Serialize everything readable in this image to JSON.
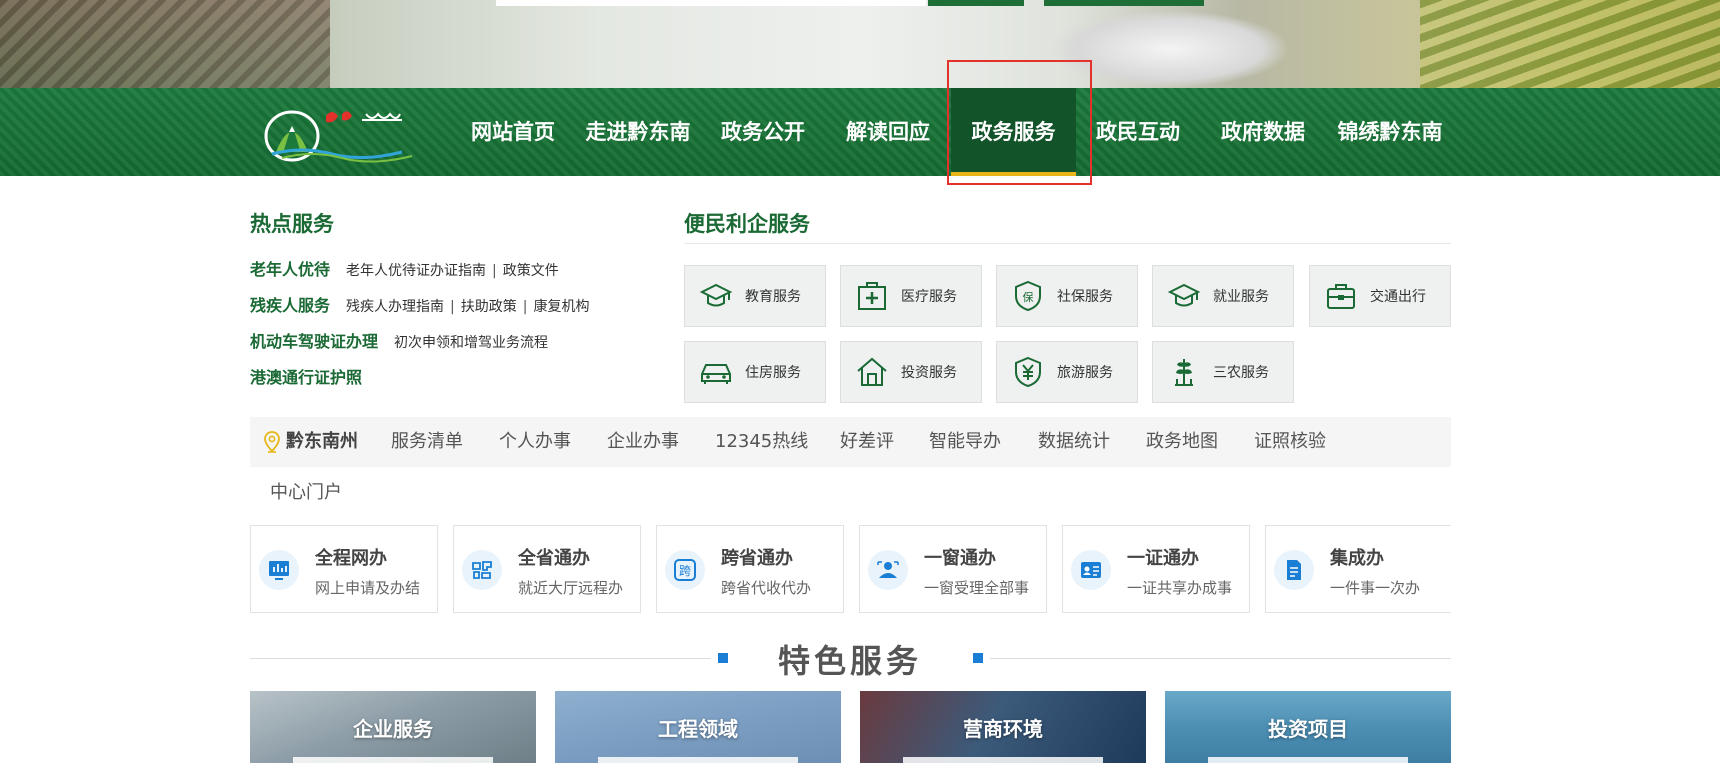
{
  "nav": {
    "items": [
      "网站首页",
      "走进黔东南",
      "政务公开",
      "解读回应",
      "政务服务",
      "政民互动",
      "政府数据",
      "锦绣黔东南"
    ],
    "active": "政务服务"
  },
  "hot": {
    "title": "热点服务",
    "rows": [
      {
        "key": "老年人优待",
        "links": [
          "老年人优待证办证指南",
          "政策文件"
        ]
      },
      {
        "key": "残疾人服务",
        "links": [
          "残疾人办理指南",
          "扶助政策",
          "康复机构"
        ]
      },
      {
        "key": "机动车驾驶证办理",
        "links": [
          "初次申领和增驾业务流程"
        ]
      },
      {
        "key": "港澳通行证护照",
        "links": []
      }
    ]
  },
  "convenience": {
    "title": "便民利企服务",
    "tiles": [
      {
        "label": "教育服务",
        "icon": "mortarboard-icon"
      },
      {
        "label": "医疗服务",
        "icon": "medical-kit-icon"
      },
      {
        "label": "社保服务",
        "icon": "shield-icon"
      },
      {
        "label": "就业服务",
        "icon": "mortarboard-icon"
      },
      {
        "label": "交通出行",
        "icon": "briefcase-icon"
      },
      {
        "label": "住房服务",
        "icon": "car-icon"
      },
      {
        "label": "投资服务",
        "icon": "house-icon"
      },
      {
        "label": "旅游服务",
        "icon": "yuan-coin-icon"
      },
      {
        "label": "三农服务",
        "icon": "wheat-icon"
      }
    ]
  },
  "tabs": {
    "location": "黔东南州",
    "items": [
      "服务清单",
      "个人办事",
      "企业办事",
      "12345热线",
      "好差评",
      "智能导办",
      "数据统计",
      "政务地图",
      "证照核验"
    ],
    "second_row": "中心门户"
  },
  "feature_cards": [
    {
      "title": "全程网办",
      "subtitle": "网上申请及办结",
      "icon": "chart-board-icon"
    },
    {
      "title": "全省通办",
      "subtitle": "就近大厅远程办",
      "icon": "province-icon"
    },
    {
      "title": "跨省通办",
      "subtitle": "跨省代收代办",
      "icon": "cross-province-icon"
    },
    {
      "title": "一窗通办",
      "subtitle": "一窗受理全部事",
      "icon": "service-window-icon"
    },
    {
      "title": "一证通办",
      "subtitle": "一证共享办成事",
      "icon": "id-card-icon"
    },
    {
      "title": "集成办",
      "subtitle": "一件事一次办",
      "icon": "document-stack-icon"
    }
  ],
  "featured": {
    "title": "特色服务",
    "cards": [
      "企业服务",
      "工程领域",
      "营商环境",
      "投资项目"
    ]
  },
  "colors": {
    "nav_green": "#1b7a3c",
    "active_tab": "#12532a",
    "accent_yellow": "#e7b518",
    "title_green": "#1b6a35",
    "highlight_red": "#e5312b",
    "card_icon_blue": "#1a7fd4"
  }
}
